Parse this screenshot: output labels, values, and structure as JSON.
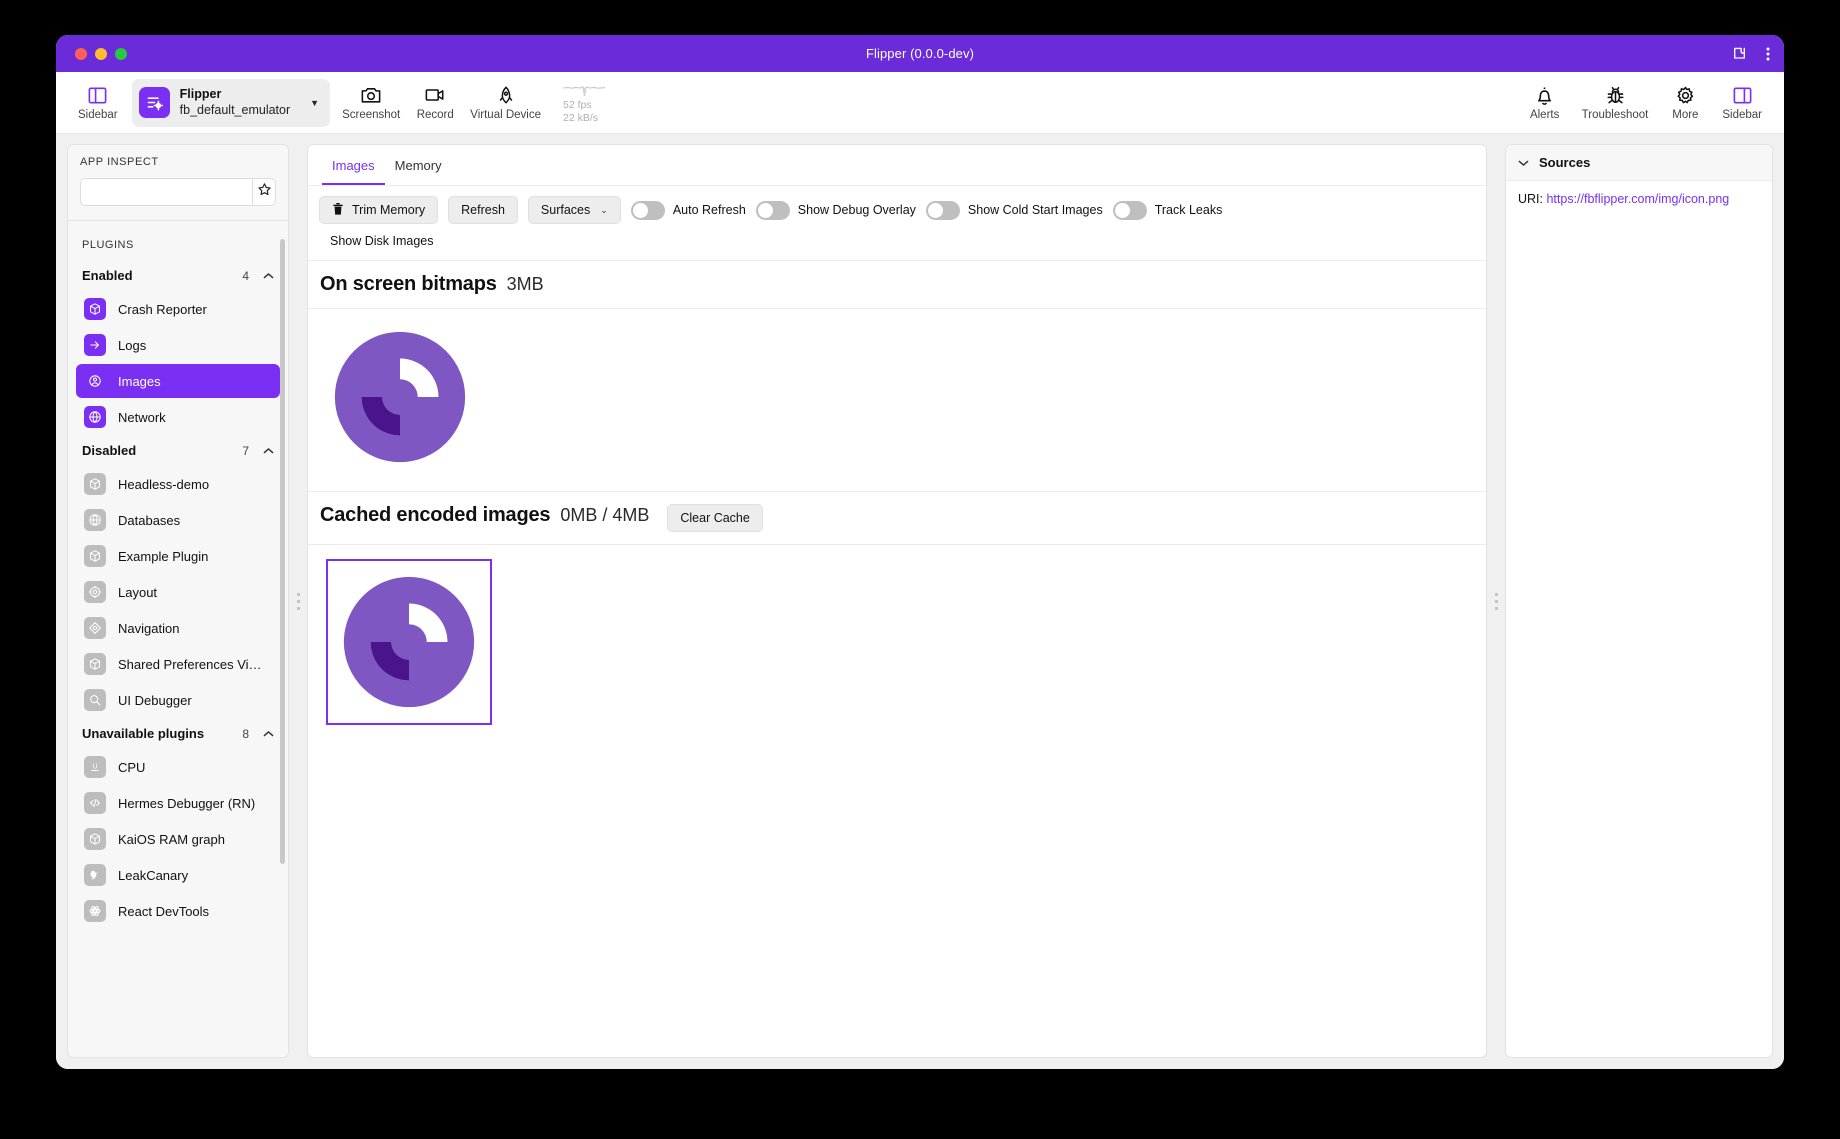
{
  "window": {
    "title": "Flipper (0.0.0-dev)",
    "accent": "#7B2FF2",
    "titlebar_bg": "#6C2BD9",
    "traffic": [
      "close",
      "minimize",
      "zoom"
    ],
    "right_icons": [
      "extensions-icon",
      "overflow-menu-icon"
    ]
  },
  "toolbar": {
    "sidebar_left": {
      "label": "Sidebar",
      "icon": "sidebar-left-icon"
    },
    "device": {
      "app_name": "Flipper",
      "device_name": "fb_default_emulator",
      "icon": "flipper-app-icon",
      "caret": "▼"
    },
    "screenshot": {
      "label": "Screenshot",
      "icon": "camera-icon"
    },
    "record": {
      "label": "Record",
      "icon": "video-camera-icon"
    },
    "virtual_device": {
      "label": "Virtual Device",
      "icon": "rocket-icon"
    },
    "perf": {
      "fps": "52 fps",
      "throughput": "22 kB/s"
    },
    "alerts": {
      "label": "Alerts",
      "icon": "bell-icon"
    },
    "troubleshoot": {
      "label": "Troubleshoot",
      "icon": "bug-icon"
    },
    "more": {
      "label": "More",
      "icon": "gear-icon"
    },
    "sidebar_right": {
      "label": "Sidebar",
      "icon": "sidebar-right-icon"
    }
  },
  "sidebar": {
    "header": "APP INSPECT",
    "search_value": "",
    "search_placeholder": "",
    "star_icon": "star-icon",
    "plugins_label": "PLUGINS",
    "groups": [
      {
        "name": "Enabled",
        "count": "4",
        "chevron": "chevron-up-icon",
        "items": [
          {
            "label": "Crash Reporter",
            "icon": "cube-icon",
            "active": false,
            "enabled": true
          },
          {
            "label": "Logs",
            "icon": "arrow-right-icon",
            "active": false,
            "enabled": true
          },
          {
            "label": "Images",
            "icon": "user-circle-icon",
            "active": true,
            "enabled": true
          },
          {
            "label": "Network",
            "icon": "globe-icon",
            "active": false,
            "enabled": true
          }
        ]
      },
      {
        "name": "Disabled",
        "count": "7",
        "chevron": "chevron-up-icon",
        "items": [
          {
            "label": "Headless-demo",
            "icon": "cube-icon",
            "active": false,
            "enabled": false
          },
          {
            "label": "Databases",
            "icon": "globe-icon",
            "active": false,
            "enabled": false
          },
          {
            "label": "Example Plugin",
            "icon": "cube-icon",
            "active": false,
            "enabled": false
          },
          {
            "label": "Layout",
            "icon": "target-icon",
            "active": false,
            "enabled": false
          },
          {
            "label": "Navigation",
            "icon": "compass-icon",
            "active": false,
            "enabled": false
          },
          {
            "label": "Shared Preferences Vi…",
            "icon": "cube-icon",
            "active": false,
            "enabled": false
          },
          {
            "label": "UI Debugger",
            "icon": "search-icon",
            "active": false,
            "enabled": false
          }
        ]
      },
      {
        "name": "Unavailable plugins",
        "count": "8",
        "chevron": "chevron-up-icon",
        "items": [
          {
            "label": "CPU",
            "icon": "cpu-icon",
            "active": false,
            "enabled": false
          },
          {
            "label": "Hermes Debugger (RN)",
            "icon": "code-icon",
            "active": false,
            "enabled": false
          },
          {
            "label": "KaiOS RAM graph",
            "icon": "cube-icon",
            "active": false,
            "enabled": false
          },
          {
            "label": "LeakCanary",
            "icon": "bird-icon",
            "active": false,
            "enabled": false
          },
          {
            "label": "React DevTools",
            "icon": "atom-icon",
            "active": false,
            "enabled": false
          }
        ]
      }
    ]
  },
  "main": {
    "tabs": [
      {
        "label": "Images",
        "active": true
      },
      {
        "label": "Memory",
        "active": false
      }
    ],
    "controls": {
      "trim_memory": {
        "label": "Trim Memory",
        "icon": "trash-icon"
      },
      "refresh": {
        "label": "Refresh"
      },
      "surfaces": {
        "label": "Surfaces",
        "caret": "⌄"
      },
      "toggles": [
        {
          "label": "Auto Refresh",
          "on": false
        },
        {
          "label": "Show Debug Overlay",
          "on": false
        },
        {
          "label": "Show Cold Start Images",
          "on": false
        },
        {
          "label": "Track Leaks",
          "on": false
        }
      ],
      "show_disk_images": "Show Disk Images"
    },
    "sections": [
      {
        "title": "On screen bitmaps",
        "size": "3MB",
        "action": null,
        "images": [
          {
            "name": "flipper-logo",
            "selected": false
          }
        ]
      },
      {
        "title": "Cached encoded images",
        "size": "0MB / 4MB",
        "action": "Clear Cache",
        "images": [
          {
            "name": "flipper-logo",
            "selected": true
          }
        ]
      }
    ]
  },
  "rightbar": {
    "title": "Sources",
    "chevron": "chevron-down-icon",
    "uri_label": "URI:",
    "uri_value": "https://fbflipper.com/img/icon.png"
  }
}
